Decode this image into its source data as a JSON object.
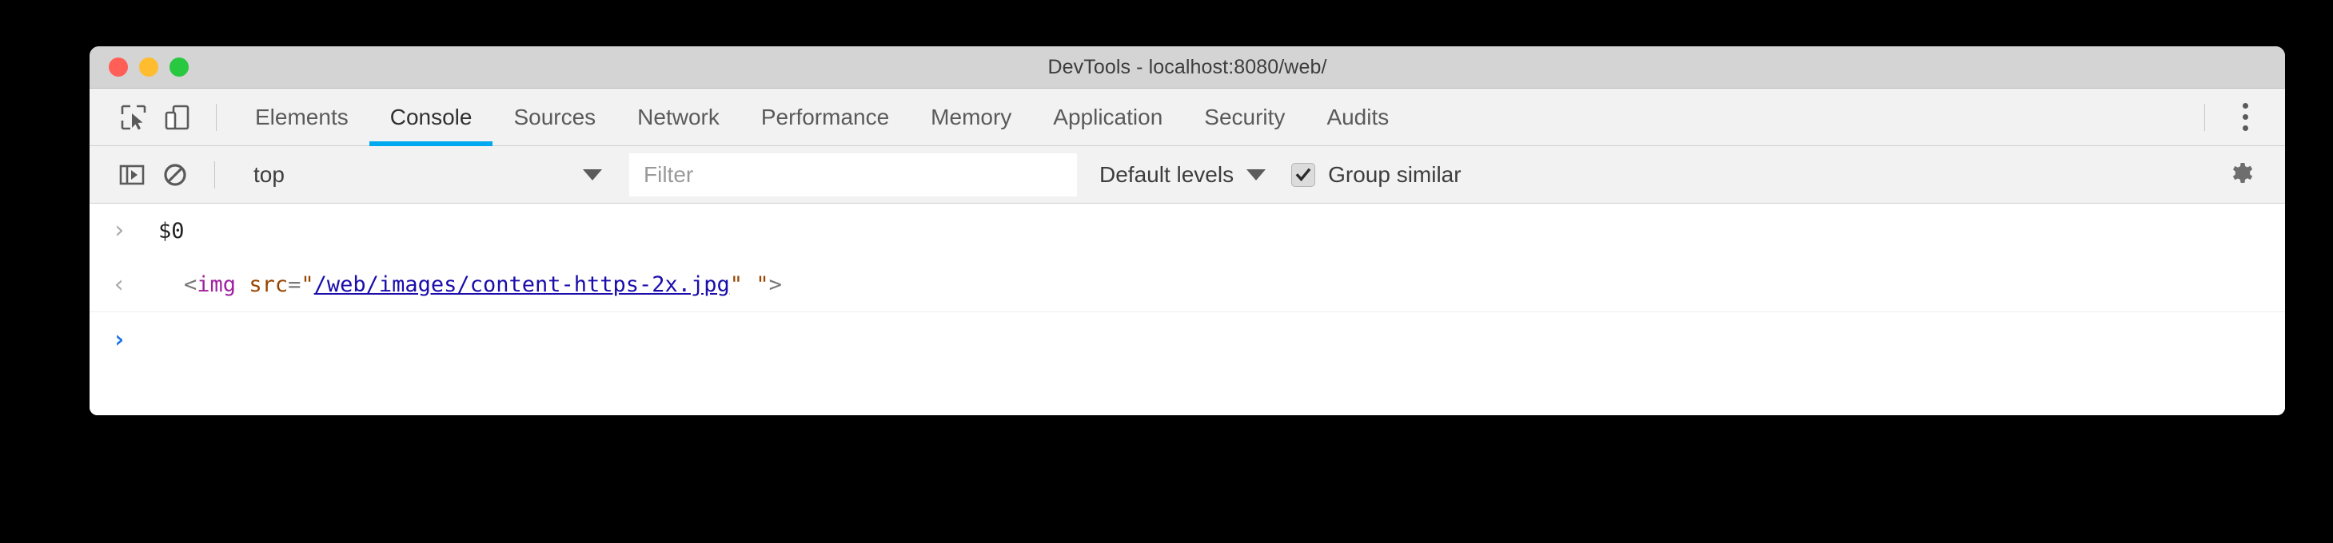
{
  "window": {
    "title": "DevTools - localhost:8080/web/",
    "traffic_lights": {
      "close_color": "#ff5f57",
      "minimize_color": "#febc2e",
      "maximize_color": "#28c840"
    }
  },
  "tabbar": {
    "inspect_icon": "inspect-element-icon",
    "device_toggle_icon": "device-toolbar-icon",
    "menu_icon": "more-options-icon",
    "active_tab": "Console",
    "accent_color": "#00a8f0",
    "tabs": [
      {
        "label": "Elements"
      },
      {
        "label": "Console"
      },
      {
        "label": "Sources"
      },
      {
        "label": "Network"
      },
      {
        "label": "Performance"
      },
      {
        "label": "Memory"
      },
      {
        "label": "Application"
      },
      {
        "label": "Security"
      },
      {
        "label": "Audits"
      }
    ]
  },
  "filterbar": {
    "sidebar_toggle_icon": "console-sidebar-icon",
    "clear_icon": "clear-console-icon",
    "context": {
      "value": "top"
    },
    "filter": {
      "value": "",
      "placeholder": "Filter"
    },
    "levels": {
      "label": "Default levels"
    },
    "group_similar": {
      "label": "Group similar",
      "checked": true
    },
    "settings_icon": "settings-gear-icon"
  },
  "console": {
    "rows": [
      {
        "type": "input",
        "prompt": "›",
        "text": "$0"
      },
      {
        "type": "output",
        "prompt": "‹",
        "tokens": {
          "open": "<",
          "tag": "img",
          "space": " ",
          "attr": "src",
          "eq": "=",
          "quote_open": "\"",
          "link": "/web/images/content-https-2x.jpg",
          "quote_close": "\"",
          "trailing": " \"",
          "close": ">"
        },
        "full_text": "<img src=\"/web/images/content-https-2x.jpg\" \">"
      },
      {
        "type": "prompt",
        "prompt": "›",
        "text": ""
      }
    ]
  }
}
